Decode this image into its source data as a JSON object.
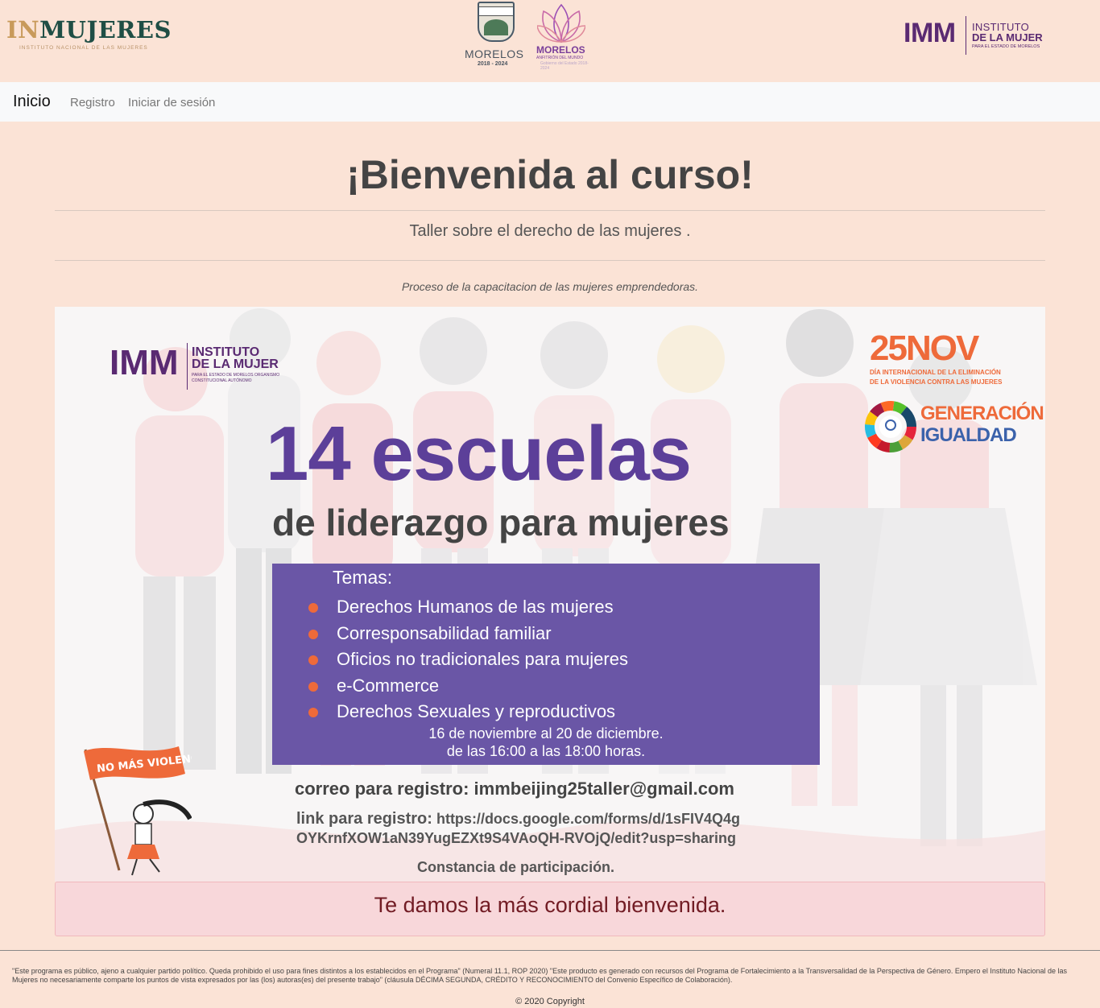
{
  "header": {
    "inmujeres": {
      "in": "IN",
      "rest": "MUJERES",
      "subtitle": "INSTITUTO NACIONAL DE LAS MUJERES"
    },
    "morelos": {
      "name": "MORELOS",
      "years": "2018 - 2024",
      "name2": "MORELOS",
      "tagline": "ANFITRIÓN DEL MUNDO",
      "tagline2": "Gobierno del Estado 2018-2024"
    },
    "imm": {
      "acronym": "IMM",
      "line1": "INSTITUTO",
      "line2": "DE LA MUJER",
      "line3": "PARA EL ESTADO DE MORELOS"
    }
  },
  "nav": {
    "brand": "Inicio",
    "links": [
      "Registro",
      "Iniciar de sesión"
    ]
  },
  "main": {
    "title": "¡Bienvenida al curso!",
    "subtitle": "Taller sobre el derecho de las mujeres .",
    "description": "Proceso de la capacitacion de las mujeres emprendedoras."
  },
  "flyer": {
    "imm": {
      "acronym": "IMM",
      "line1": "INSTITUTO",
      "line2": "DE LA MUJER",
      "line3": "PARA EL ESTADO DE MORELOS ORGANISMO CONSTITUCIONAL AUTÓNOMO"
    },
    "nov": {
      "big": "25NOV",
      "line1": "DÍA INTERNACIONAL DE LA ELIMINACIÓN",
      "line2": "DE LA VIOLENCIA CONTRA LAS MUJERES"
    },
    "generacion": {
      "line1": "GENERACIÓN",
      "line2": "IGUALDAD"
    },
    "headline": "14 escuelas",
    "subheadline": "de liderazgo para mujeres",
    "temas_label": "Temas:",
    "temas": [
      "Derechos Humanos de las mujeres",
      "Corresponsabilidad familiar",
      "Oficios no tradicionales para mujeres",
      "e-Commerce",
      "Derechos Sexuales y reproductivos"
    ],
    "dates_line1": "16 de noviembre al 20 de diciembre.",
    "dates_line2": "de las 16:00 a las 18:00 horas.",
    "correo": "correo para registro: immbeijing25taller@gmail.com",
    "link_label": "link para registro:",
    "link_url1": "https://docs.google.com/forms/d/1sFIV4Q4g",
    "link_url2": "OYKrnfXOW1aN39YugEZXt9S4VAoQH-RVOjQ/edit?usp=sharing",
    "constancia": "Constancia de participación.",
    "flag_text": "NO MÁS VIOLENCIA"
  },
  "alert": {
    "text": "Te damos la más cordial bienvenida."
  },
  "footer": {
    "text": "\"Este programa es público, ajeno a cualquier partido político. Queda prohibido el uso para fines distintos a los establecidos en el Programa\" (Numeral 11.1, ROP 2020) \"Este producto es generado con recursos del Programa de Fortalecimiento a la Transversalidad de la Perspectiva de Género. Empero el Instituto Nacional de las Mujeres no necesariamente comparte los puntos de vista expresados por las (los) autoras(es) del presente trabajo\" (cláusula DÉCIMA SEGUNDA, CRÉDITO Y RECONOCIMIENTO del Convenio Específico de Colaboración).",
    "copyright": "© 2020 Copyright"
  },
  "colors": {
    "page_bg": "#fbe3d6",
    "navbar_bg": "#f8f9fa",
    "purple": "#5c3f99",
    "orange": "#ee6a3a",
    "alert_bg": "#f8d7da",
    "alert_text": "#721c24"
  }
}
